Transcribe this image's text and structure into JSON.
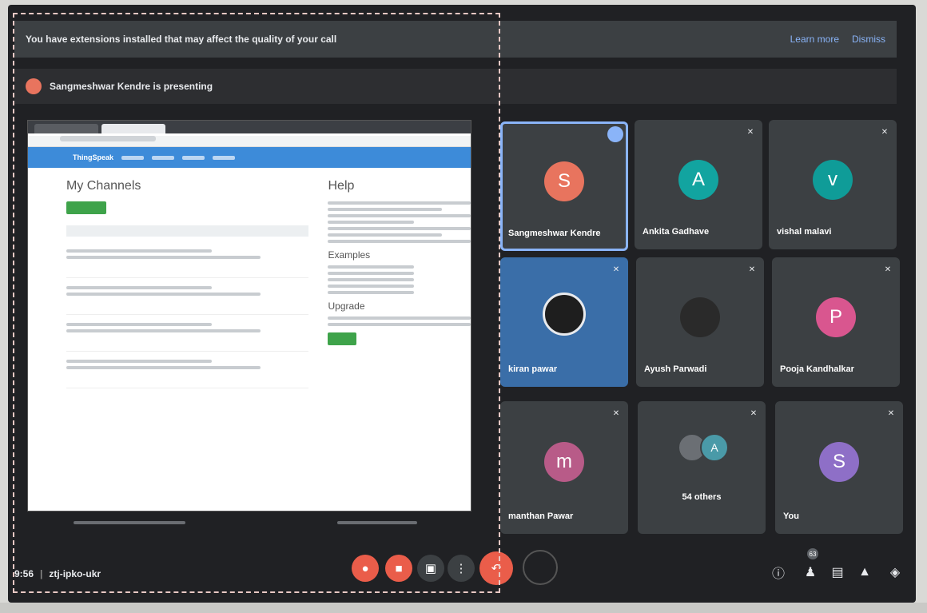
{
  "banner": {
    "text": "You have extensions installed that may affect the quality of your call",
    "learn_more": "Learn more",
    "dismiss": "Dismiss"
  },
  "presenting": {
    "text": "Sangmeshwar Kendre is presenting"
  },
  "shared_screen": {
    "site": "ThingSpeak",
    "heading_left": "My Channels",
    "heading_help": "Help",
    "heading_examples": "Examples",
    "heading_upgrade": "Upgrade"
  },
  "participants": [
    {
      "name": "Sangmeshwar Kendre",
      "initial": "S",
      "color": "#e8745e"
    },
    {
      "name": "Ankita Gadhave",
      "initial": "A",
      "color": "#12a4a0"
    },
    {
      "name": "vishal malavi",
      "initial": "v",
      "color": "#0f9c98"
    },
    {
      "name": "kiran pawar"
    },
    {
      "name": "Ayush Parwadi"
    },
    {
      "name": "Pooja Kandhalkar",
      "initial": "P",
      "color": "#d9568f"
    },
    {
      "name": "manthan Pawar",
      "initial": "m",
      "color": "#b85b88"
    },
    {
      "name": "54 others",
      "initial": "A",
      "color": "#4a9aa8"
    },
    {
      "name": "You",
      "initial": "S",
      "color": "#8e6fc7"
    }
  ],
  "meeting": {
    "time": "9:56",
    "code": "ztj-ipko-ukr",
    "people_count": "63"
  },
  "icons": {
    "mic": "mic-icon",
    "camera": "camera-icon",
    "captions": "captions-icon",
    "more": "more-vert-icon",
    "end": "call-end-icon",
    "info": "info-icon",
    "people": "people-icon",
    "chat": "chat-icon",
    "activities": "activities-icon",
    "host": "host-controls-icon"
  }
}
